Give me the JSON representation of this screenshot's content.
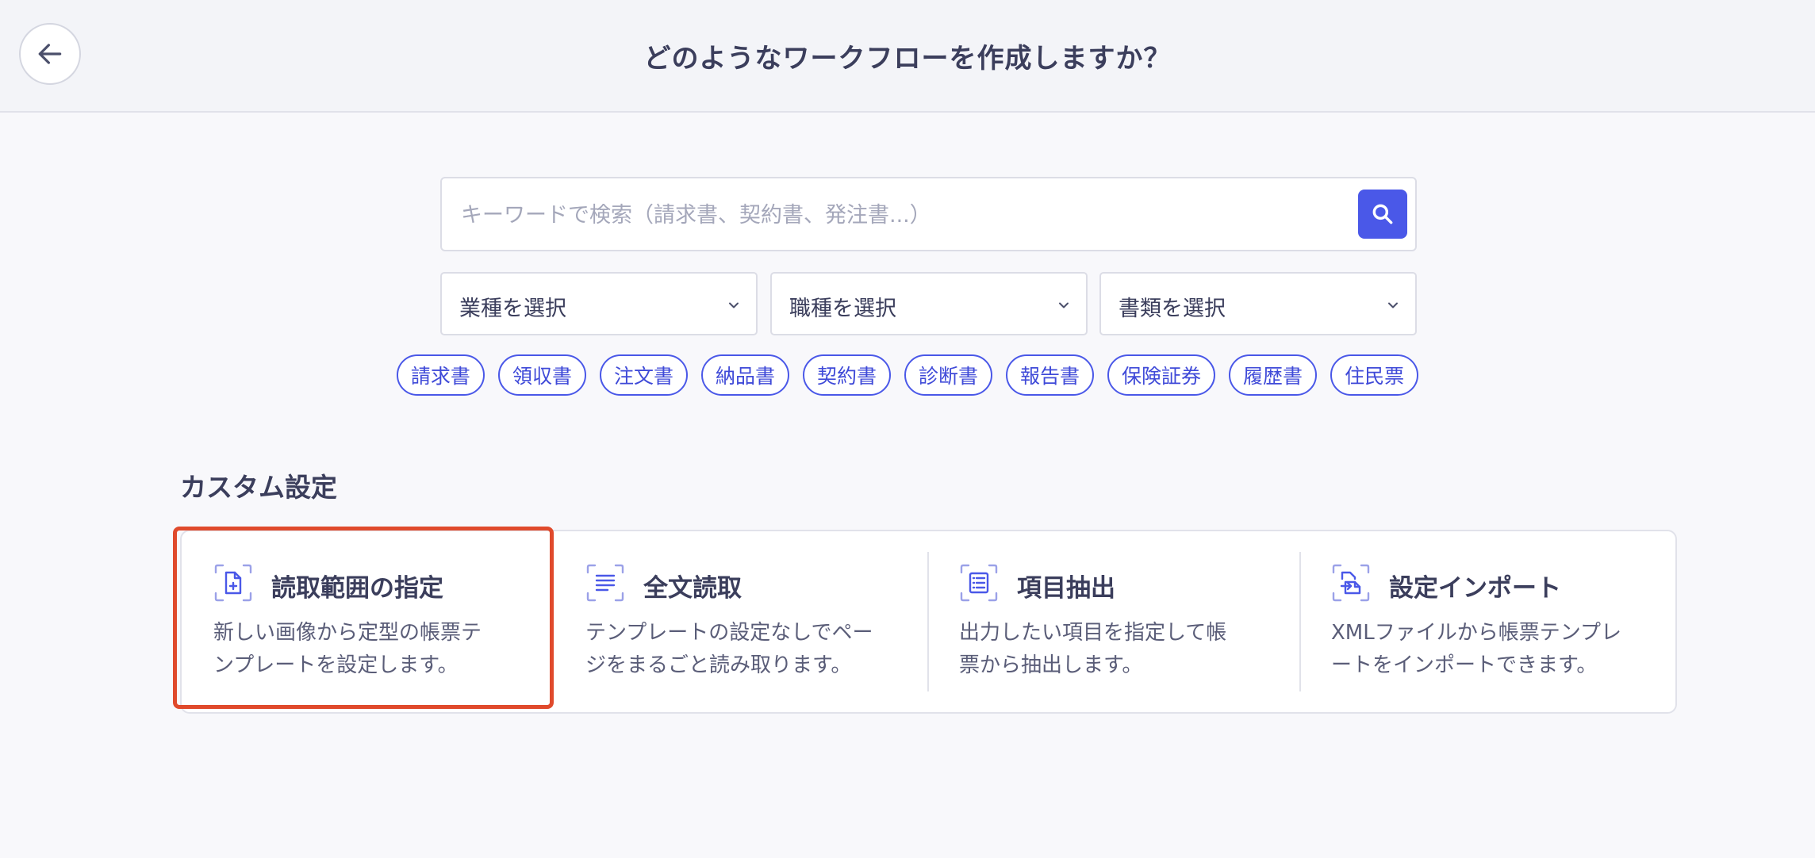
{
  "header": {
    "title": "どのようなワークフローを作成しますか？"
  },
  "search": {
    "placeholder": "キーワードで検索（請求書、契約書、発注書...）"
  },
  "filters": {
    "industry_label": "業種を選択",
    "job_label": "職種を選択",
    "document_label": "書類を選択"
  },
  "tags": [
    "請求書",
    "領収書",
    "注文書",
    "納品書",
    "契約書",
    "診断書",
    "報告書",
    "保険証券",
    "履歴書",
    "住民票"
  ],
  "custom": {
    "section_title": "カスタム設定",
    "cards": [
      {
        "title": "読取範囲の指定",
        "desc_line1": "新しい画像から定型の帳票テ",
        "desc_line2": "ンプレートを設定します。"
      },
      {
        "title": "全文読取",
        "desc_line1": "テンプレートの設定なしでペー",
        "desc_line2": "ジをまるごと読み取ります。"
      },
      {
        "title": "項目抽出",
        "desc_line1": "出力したい項目を指定して帳",
        "desc_line2": "票から抽出します。"
      },
      {
        "title": "設定インポート",
        "desc_line1": "XMLファイルから帳票テンプレ",
        "desc_line2": "ートをインポートできます。"
      }
    ]
  },
  "icons": {
    "back": "arrow-left-icon",
    "search": "search-icon",
    "chevron": "chevron-down-icon",
    "card_1": "file-plus-scan-icon",
    "card_2": "text-lines-scan-icon",
    "card_3": "list-scan-icon",
    "card_4": "file-import-scan-icon"
  },
  "colors": {
    "accent": "#4a58e8",
    "highlight": "#e04a2c"
  }
}
